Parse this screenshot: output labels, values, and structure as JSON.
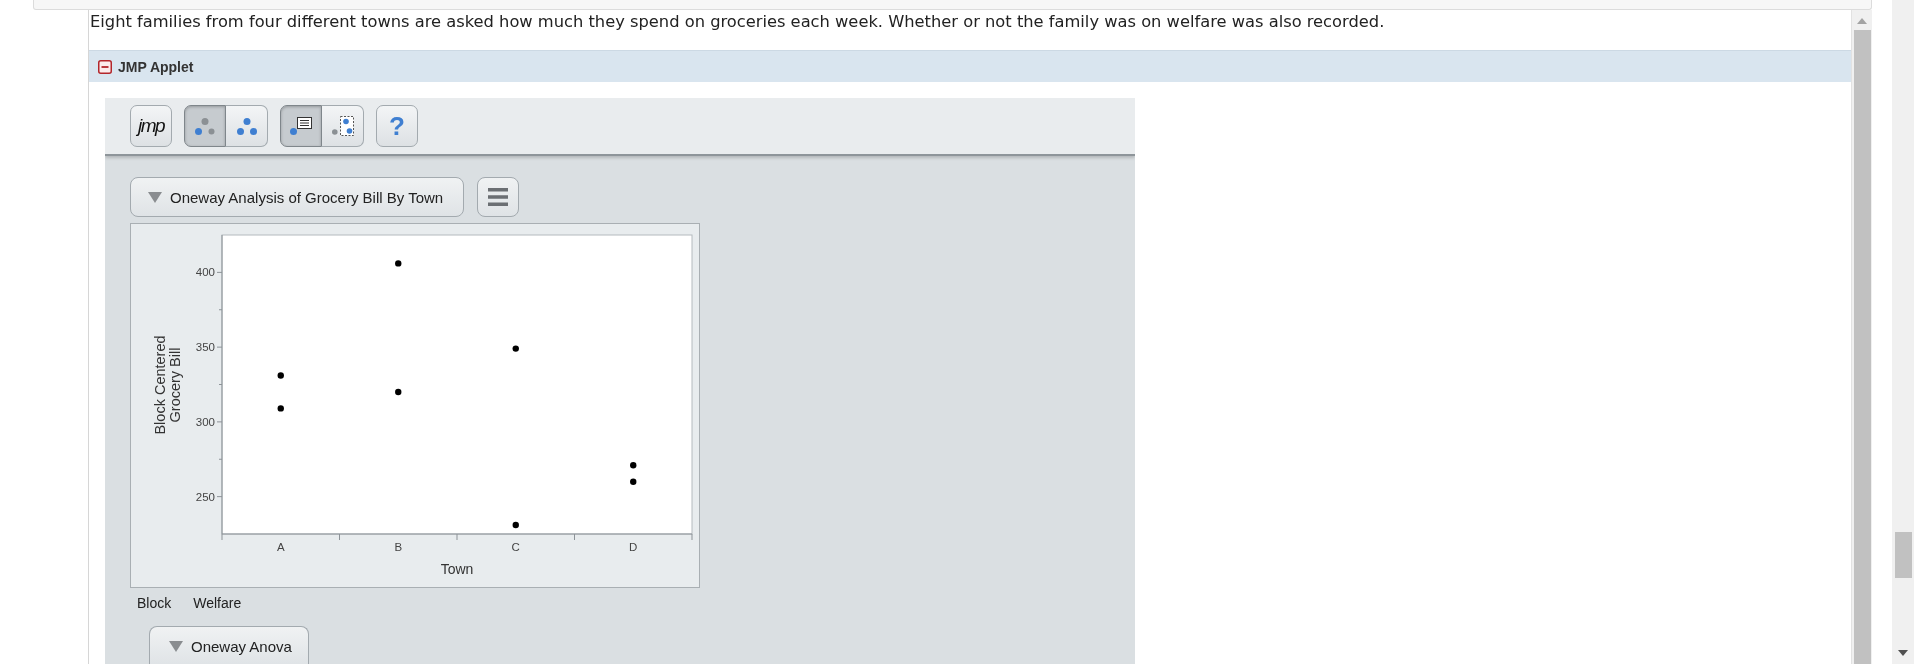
{
  "intro": "Eight families from four different towns are asked how much they spend on groceries each week. Whether or not the family was on welfare was also recorded.",
  "section": {
    "title": "JMP Applet",
    "expanded": true
  },
  "toolbar": {
    "logo": "jmp",
    "groups": [
      {
        "buttons": [
          {
            "kind": "dots-mixed",
            "selected": true
          },
          {
            "kind": "dots-blue",
            "selected": false
          }
        ]
      },
      {
        "buttons": [
          {
            "kind": "report",
            "selected": true
          },
          {
            "kind": "dashed-box",
            "selected": false
          }
        ]
      }
    ],
    "help": "?"
  },
  "report": {
    "title": "Oneway Analysis of Grocery Bill By Town",
    "expanded": true,
    "chart_data": {
      "type": "scatter",
      "xlabel": "Town",
      "ylabel": "Block Centered Grocery Bill",
      "categories": [
        "A",
        "B",
        "C",
        "D"
      ],
      "series": [
        {
          "color": "#000000",
          "values": [
            331,
            406,
            349,
            271
          ]
        },
        {
          "color": "#000000",
          "values": [
            309,
            320,
            231,
            260
          ]
        }
      ],
      "ylim": [
        225,
        425
      ],
      "yticks": [
        250,
        300,
        350,
        400
      ]
    },
    "labels": [
      "Block",
      "Welfare"
    ],
    "subreport": {
      "title": "Oneway Anova",
      "expanded": true
    }
  }
}
